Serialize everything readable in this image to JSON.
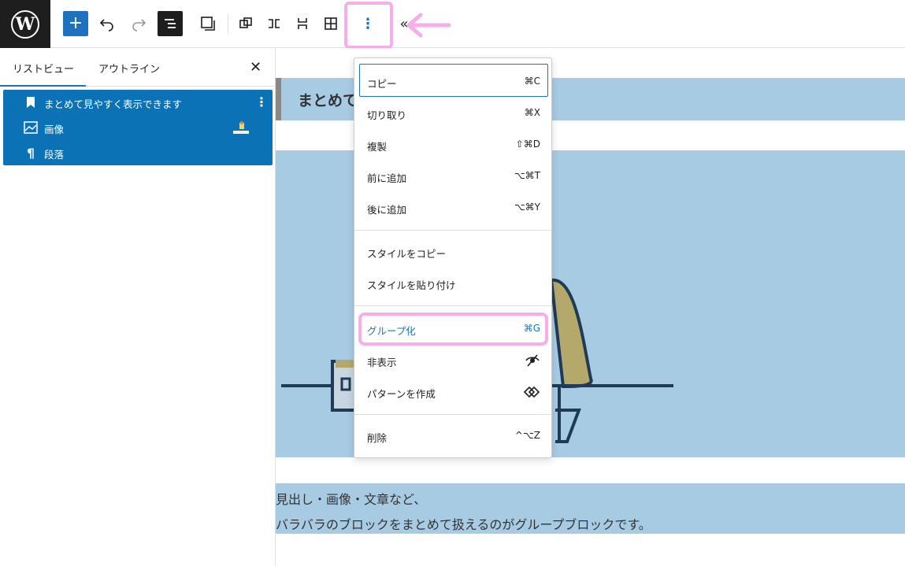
{
  "toolbar": {
    "logo": "wordpress-logo",
    "add": "+",
    "more_options": "⋮",
    "collapse": "«"
  },
  "sidebar": {
    "tabs": [
      {
        "label": "リストビュー"
      },
      {
        "label": "アウトライン"
      }
    ],
    "close": "✕",
    "items": [
      {
        "label": "まとめて見やすく表示できます",
        "icon": "bookmark-icon"
      },
      {
        "label": "画像",
        "icon": "image-icon"
      },
      {
        "label": "段落",
        "icon": "paragraph-icon"
      }
    ]
  },
  "canvas": {
    "heading": "まとめて",
    "paragraph_lines": [
      "見出し・画像・文章など、",
      "バラバラのブロックをまとめて扱えるのがグループブロックです。"
    ]
  },
  "menu": {
    "items": [
      {
        "label": "コピー",
        "shortcut": "⌘C"
      },
      {
        "label": "切り取り",
        "shortcut": "⌘X"
      },
      {
        "label": "複製",
        "shortcut": "⇧⌘D"
      },
      {
        "label": "前に追加",
        "shortcut": "⌥⌘T"
      },
      {
        "label": "後に追加",
        "shortcut": "⌥⌘Y"
      },
      {
        "label": "スタイルをコピー",
        "shortcut": ""
      },
      {
        "label": "スタイルを貼り付け",
        "shortcut": ""
      },
      {
        "label": "グループ化",
        "shortcut": "⌘G"
      },
      {
        "label": "非表示",
        "shortcut": ""
      },
      {
        "label": "パターンを作成",
        "shortcut": ""
      },
      {
        "label": "削除",
        "shortcut": "^⌥Z"
      }
    ]
  },
  "colors": {
    "accent": "#1e72bd",
    "highlight": "#f7aee8",
    "block_bg": "#a8cbe4"
  }
}
